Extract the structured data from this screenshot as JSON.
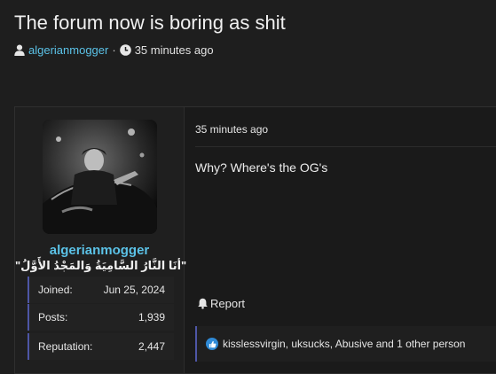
{
  "thread": {
    "title": "The forum now is boring as shit",
    "author": "algerianmogger",
    "separator": "·",
    "time_ago": "35 minutes ago"
  },
  "post": {
    "user": {
      "username": "algerianmogger",
      "user_title": "\"أنَا النَّارُ السَّامِيَةُ وَالمَجْدُ الأَوَّلُ\"",
      "stats": [
        {
          "label": "Joined:",
          "value": "Jun 25, 2024"
        },
        {
          "label": "Posts:",
          "value": "1,939"
        },
        {
          "label": "Reputation:",
          "value": "2,447"
        }
      ]
    },
    "date": "35 minutes ago",
    "body": "Why? Where's the OG's",
    "report_label": "Report",
    "reactions_text": "kisslessvirgin, uksucks, Abusive and 1 other person"
  },
  "colors": {
    "accent": "#5bc2e7",
    "stat_border": "#4e56a6",
    "like": "#2f8ad6"
  },
  "icons": {
    "author": "user-icon",
    "time": "clock-icon",
    "report": "bell-icon",
    "reaction": "thumbs-up-icon"
  }
}
